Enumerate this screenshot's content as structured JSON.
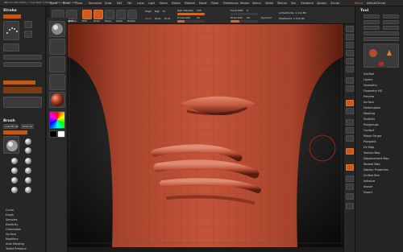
{
  "titlebar": {
    "text": "ZBrush 4R6 (64bit) • Free Mem 3.45GB • Active Mem 1.2GB"
  },
  "menu": [
    "Alpha",
    "Brush",
    "Color",
    "Document",
    "Draw",
    "Edit",
    "File",
    "Layer",
    "Light",
    "Macro",
    "Marker",
    "Material",
    "Movie",
    "Picker",
    "Preferences",
    "Render",
    "Stencil",
    "Stroke",
    "Texture",
    "Tool",
    "Transform",
    "Zplugin",
    "Zscript"
  ],
  "menu_right": [
    "Menus",
    "DefaultZScript"
  ],
  "stroke_panel": {
    "title": "Stroke",
    "preset": "Default",
    "items": [
      "Freehand",
      "Dots",
      "Lazy Mouse",
      "Roll",
      "Curve"
    ]
  },
  "brush_panel": {
    "title": "Brush",
    "buttons": [
      "Load Brush",
      "Save As"
    ],
    "items": [
      "Curve",
      "Depth",
      "Samples",
      "Elasticity",
      "Orientation",
      "Surface",
      "Modifiers",
      "Auto Masking",
      "Tablet Pressure",
      "Alpha and Texture",
      "Clip Brush Modifiers",
      "Smooth Brush Modifiers"
    ]
  },
  "toolbar": {
    "buttons": [
      "Projection Master",
      "LightBox",
      "Edit",
      "Draw",
      "Move",
      "Scale",
      "Rotate"
    ],
    "mrgb": "Mrgb",
    "rgb": "Rgb",
    "m": "M",
    "zadd": "Zadd",
    "zsub": "Zsub",
    "zcut": "Zcut",
    "rgb_intensity": {
      "label": "Rgb Intensity",
      "value": 100
    },
    "z_intensity": {
      "label": "Z Intensity",
      "value": 25
    },
    "focal_shift": {
      "label": "Focal Shift",
      "value": 0
    },
    "draw_size": {
      "label": "Draw Size",
      "value": 64
    },
    "active_points": "ActivePoints: 1.114 Mil",
    "total_points": "TotalPoints: 1.114 Mil",
    "dynamic": "Dynamic"
  },
  "colors": {
    "accent": "#d05a1a",
    "clay": "#b44a32",
    "background": "#1f1f1f"
  },
  "tool_panel": {
    "title": "Tool",
    "buttons": [
      "Load Tool",
      "Save As",
      "Copy Tool",
      "Paste Tool",
      "Import",
      "Export",
      "Clone",
      "Make PolyMesh3D",
      "GoZ",
      "All",
      "Visible",
      "R"
    ],
    "subtools": [],
    "sections": [
      "SubTool",
      "Layers",
      "Geometry",
      "Geometry HD",
      "Preview",
      "Surface",
      "Deformation",
      "Masking",
      "Visibility",
      "Polygroups",
      "Contact",
      "Morph Target",
      "Polypaint",
      "UV Map",
      "Texture Map",
      "Displacement Map",
      "Normal Map",
      "Display Properties",
      "Unified Skin",
      "Initialize",
      "Import",
      "Export"
    ]
  },
  "right_strip": [
    "BPR",
    "SPix",
    "Scroll",
    "Zoom",
    "Actual",
    "AAHalf",
    "Persp",
    "Floor",
    "Local",
    "L.Sym",
    "Frame",
    "Move",
    "Scale",
    "Rotate",
    "PolyF",
    "Transp",
    "Ghost",
    "Solo",
    "Xpose"
  ]
}
